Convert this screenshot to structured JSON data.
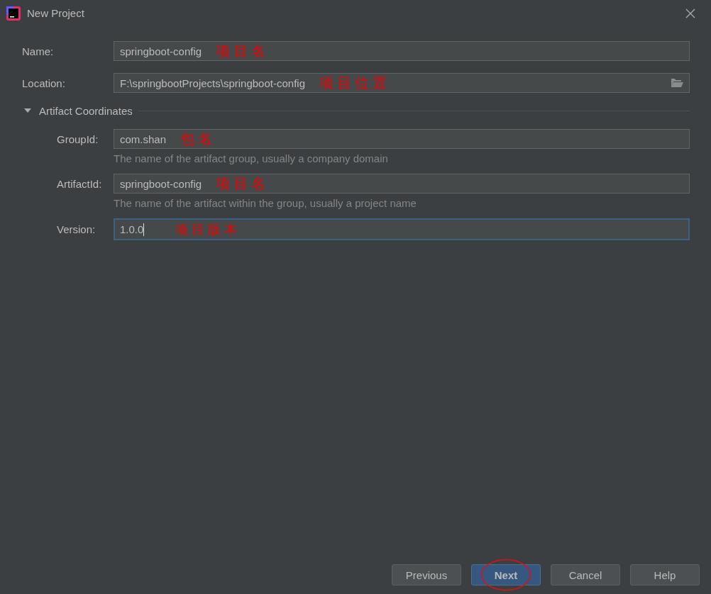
{
  "window": {
    "title": "New Project"
  },
  "fields": [
    {
      "kind": "text",
      "label": "Name:",
      "value": "springboot-config",
      "annotation": "项目名",
      "focused": false
    },
    {
      "kind": "browse",
      "label": "Location:",
      "value": "F:\\springbootProjects\\springboot-config",
      "annotation": "项目位置",
      "focused": false
    }
  ],
  "section": {
    "title": "Artifact Coordinates",
    "expanded": true,
    "fields": [
      {
        "label": "GroupId:",
        "value": "com.shan",
        "annotation": "包名",
        "focused": false,
        "hint": "The name of the artifact group, usually a company domain"
      },
      {
        "label": "ArtifactId:",
        "value": "springboot-config",
        "annotation": "项目名",
        "focused": false,
        "hint": "The name of the artifact within the group, usually a project name"
      },
      {
        "label": "Version:",
        "value": "1.0.0",
        "annotation": "项目版本",
        "focused": true
      }
    ]
  },
  "buttons": [
    {
      "label": "Previous",
      "default": false,
      "circled": false
    },
    {
      "label": "Next",
      "default": true,
      "circled": true
    },
    {
      "label": "Cancel",
      "default": false,
      "circled": false
    },
    {
      "label": "Help",
      "default": false,
      "circled": false
    }
  ]
}
